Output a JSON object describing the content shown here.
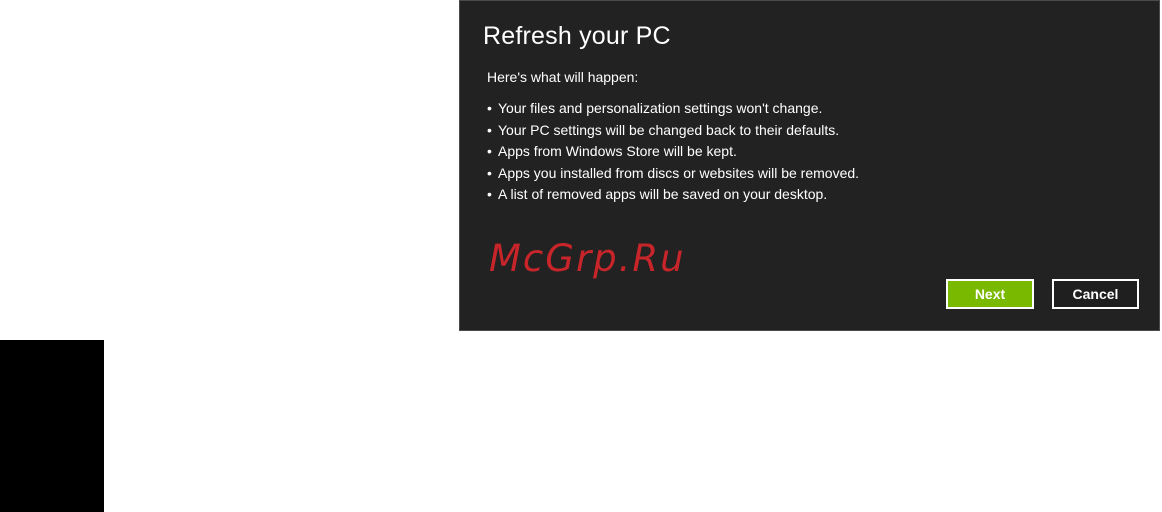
{
  "dialog": {
    "title": "Refresh your PC",
    "intro": "Here's what will happen:",
    "bullet_symbol": "•",
    "bullets": [
      "Your files and personalization settings won't change.",
      "Your PC settings will be changed back to their defaults.",
      "Apps from Windows Store will be kept.",
      "Apps you installed from discs or websites will be removed.",
      "A list of removed apps will be saved on your desktop."
    ],
    "buttons": {
      "next_label": "Next",
      "cancel_label": "Cancel"
    }
  },
  "watermark": {
    "text": "McGrp.Ru"
  },
  "colors": {
    "dialog_background": "#222222",
    "next_button": "#79b900",
    "watermark": "#d9262b"
  }
}
